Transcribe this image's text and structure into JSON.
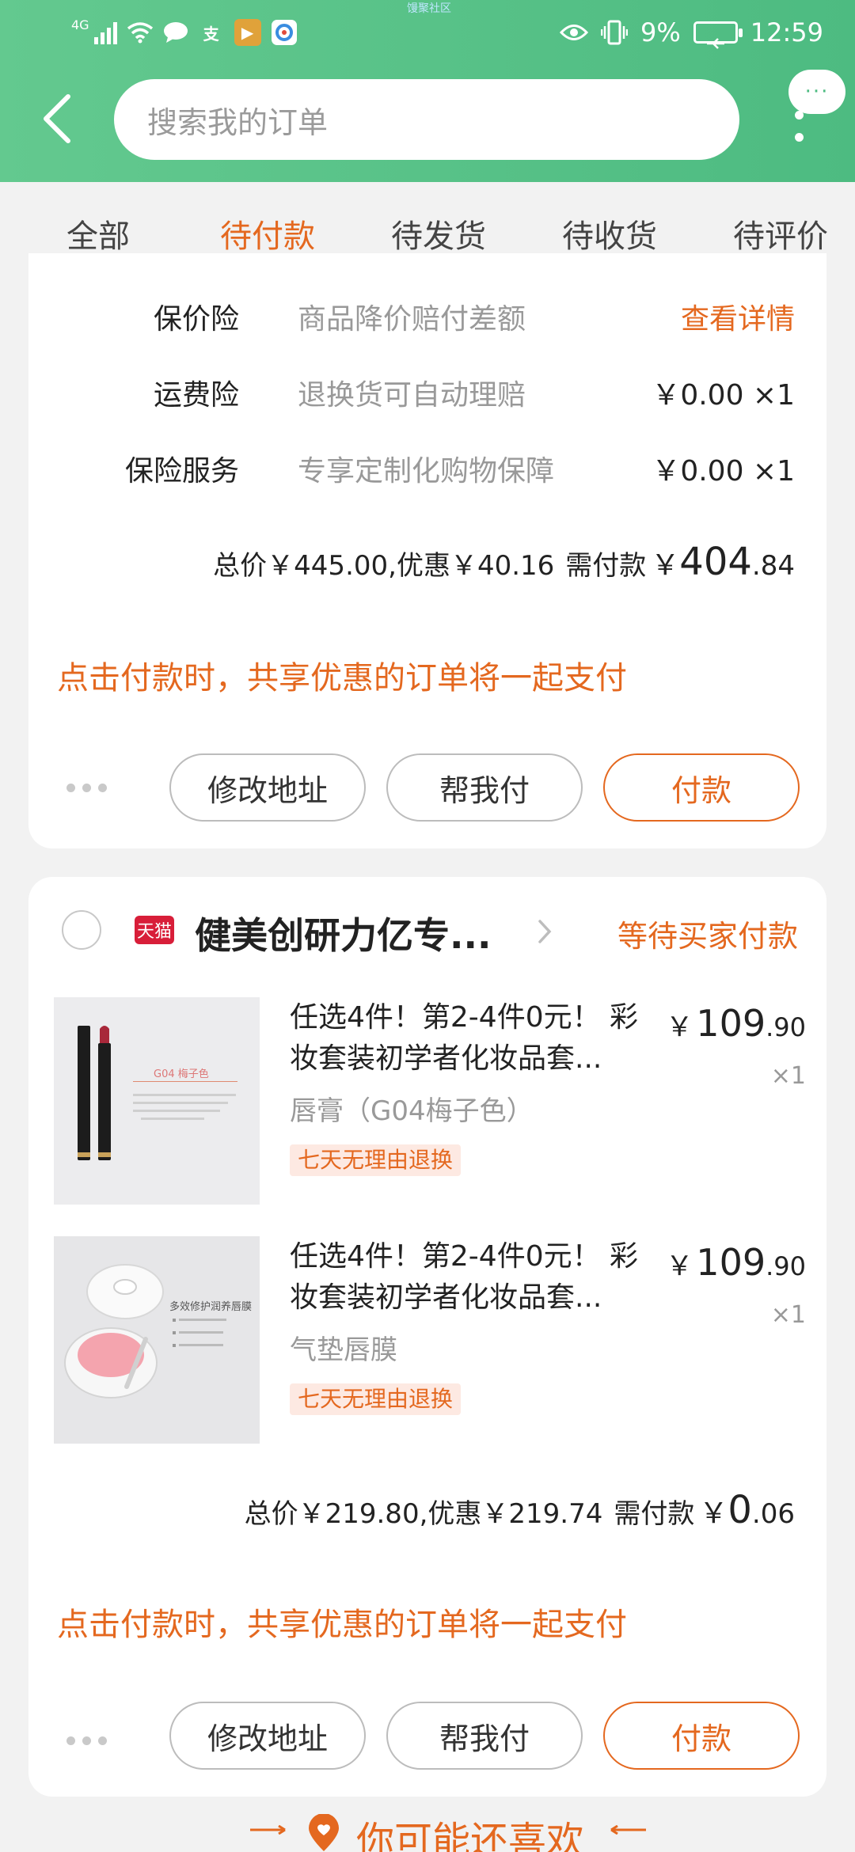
{
  "status_bar": {
    "network": "4G",
    "battery": "9%",
    "time": "12:59",
    "watermark": "馒聚社区",
    "app_icon_a": "支",
    "app_icon_b": "▶"
  },
  "header": {
    "search_placeholder": "搜索我的订单",
    "message_button": "···"
  },
  "tabs": [
    {
      "label": "全部"
    },
    {
      "label": "待付款"
    },
    {
      "label": "待发货"
    },
    {
      "label": "待收货"
    },
    {
      "label": "待评价"
    }
  ],
  "active_tab": "待付款",
  "order1": {
    "insurance": [
      {
        "label": "保价险",
        "desc": "商品降价赔付差额",
        "value": "查看详情"
      },
      {
        "label": "运费险",
        "desc": "退换货可自动理赔",
        "value": "￥0.00 ×1"
      },
      {
        "label": "保险服务",
        "desc": "专享定制化购物保障",
        "value": "￥0.00 ×1"
      }
    ],
    "summary": "总价￥445.00,优惠￥40.16",
    "due_label": "需付款",
    "due_currency": "￥",
    "due_int": "404",
    "due_dec": ".84",
    "notice": "点击付款时，共享优惠的订单将一起支付",
    "buttons": {
      "modify": "修改地址",
      "help": "帮我付",
      "pay": "付款"
    }
  },
  "order2": {
    "shop_badge": "天猫",
    "shop_name": "健美创研力亿专...",
    "status": "等待买家付款",
    "items": [
      {
        "title_line1": "任选4件！第2-4件0元！ 彩",
        "title_line2": "妆套装初学者化妆品套...",
        "sku": "唇膏（G04梅子色）",
        "tag": "七天无理由退换",
        "price_currency": "￥",
        "price_int": "109",
        "price_dec": ".90",
        "qty": "×1",
        "thumb_text": "G04 梅子色"
      },
      {
        "title_line1": "任选4件！第2-4件0元！ 彩",
        "title_line2": "妆套装初学者化妆品套...",
        "sku": "气垫唇膜",
        "tag": "七天无理由退换",
        "price_currency": "￥",
        "price_int": "109",
        "price_dec": ".90",
        "qty": "×1",
        "thumb_text": "多效修护润养唇膜"
      }
    ],
    "summary": "总价￥219.80,优惠￥219.74",
    "due_label": "需付款",
    "due_currency": "￥",
    "due_int": "0",
    "due_dec": ".06",
    "notice": "点击付款时，共享优惠的订单将一起支付",
    "buttons": {
      "modify": "修改地址",
      "help": "帮我付",
      "pay": "付款"
    }
  },
  "recommend": {
    "heading": "你可能还喜欢"
  },
  "colors": {
    "header_green": "#4dbb81",
    "accent_orange": "#e4681f",
    "tmall_red": "#d81e39"
  }
}
